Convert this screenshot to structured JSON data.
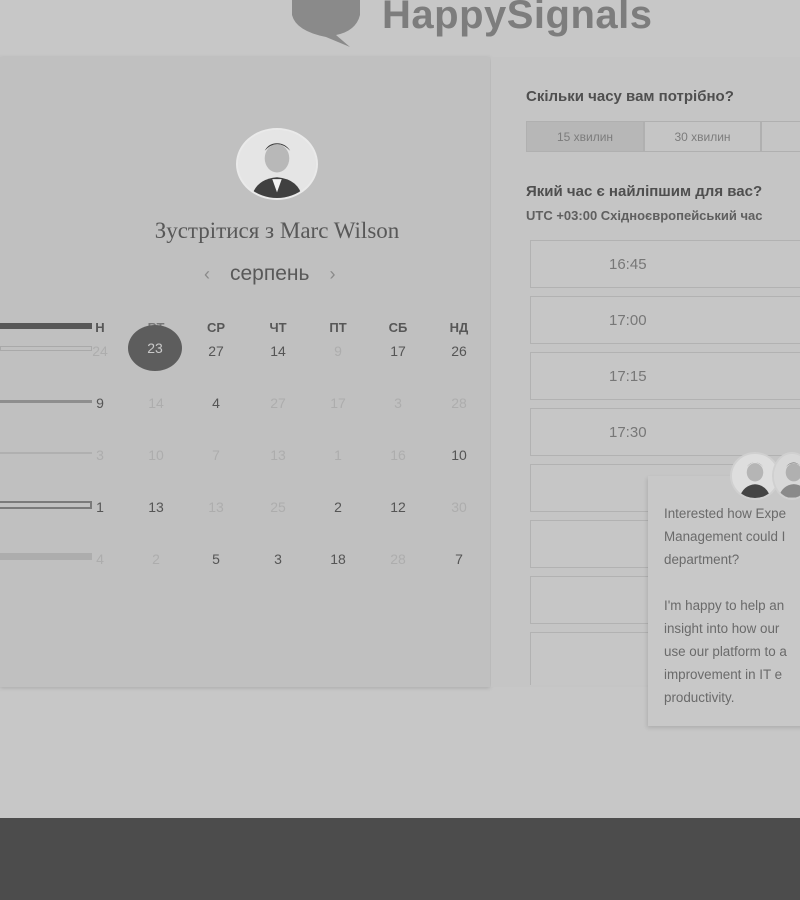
{
  "brand": {
    "name": "HappySignals"
  },
  "left": {
    "title": "Зустрітися з Marc Wilson",
    "month": "серпень",
    "prev_icon": "‹",
    "next_icon": "›",
    "weekdays": [
      "Н",
      "ВТ",
      "СР",
      "ЧТ",
      "ПТ",
      "СБ",
      "НД"
    ],
    "selected_day": "23",
    "rows": [
      [
        "24",
        "23",
        "27",
        "14",
        "9",
        "17",
        "26"
      ],
      [
        "9",
        "14",
        "4",
        "27",
        "17",
        "3",
        "28"
      ],
      [
        "3",
        "10",
        "7",
        "13",
        "1",
        "16",
        "10"
      ],
      [
        "1",
        "13",
        "13",
        "25",
        "2",
        "12",
        "30"
      ],
      [
        "4",
        "2",
        "5",
        "3",
        "18",
        "28",
        "7"
      ]
    ]
  },
  "right": {
    "duration_question": "Скільки часу вам потрібно?",
    "durations": [
      "15 хвилин",
      "30 хвилин"
    ],
    "time_question": "Який час є найліпшим для вас?",
    "timezone": "UTC +03:00 Східноєвропейський час",
    "slots": [
      "16:45",
      "17:00",
      "17:15",
      "17:30",
      "",
      "",
      "",
      ""
    ]
  },
  "chat": {
    "lines1": [
      "Interested how Expe",
      "Management could I",
      "department?"
    ],
    "lines2": [
      "I'm happy to help an",
      "insight into how our",
      "use our platform to a",
      "improvement in IT e",
      "productivity."
    ]
  },
  "colors": {
    "footer": "#4c4c4c",
    "selected_day": "#5d5d5d",
    "overlay": "#c7c7c7"
  }
}
